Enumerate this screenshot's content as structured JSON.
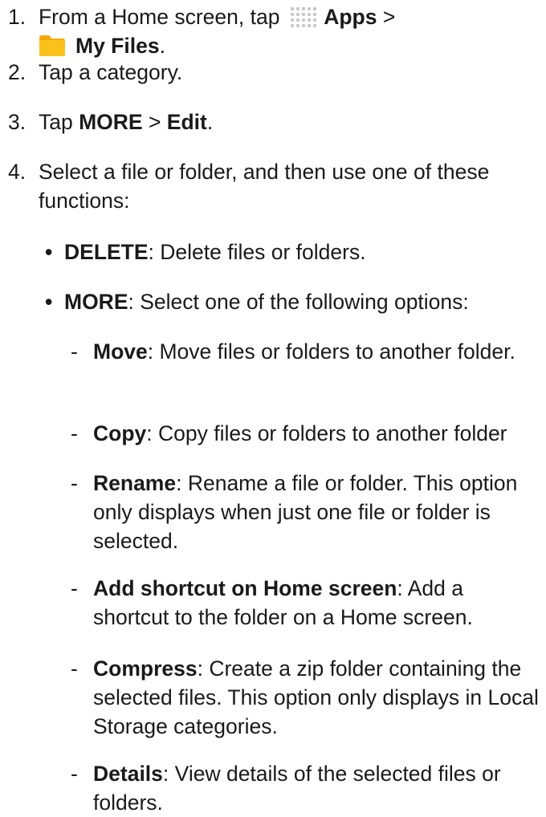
{
  "steps": [
    {
      "num": "1.",
      "pre": "From a Home screen, tap",
      "apps": "Apps",
      "sep": " >",
      "folder": "My Files",
      "end": "."
    },
    {
      "num": "2.",
      "text": "Tap a category."
    },
    {
      "num": "3.",
      "pre": "Tap ",
      "more": "MORE",
      "sep": " > ",
      "edit": "Edit",
      "end": "."
    },
    {
      "num": "4.",
      "text": "Select a file or folder, and then use one of these functions:"
    }
  ],
  "bullets": [
    {
      "marker": "•",
      "term": "DELETE",
      "desc": ": Delete files or folders."
    },
    {
      "marker": "•",
      "term": "MORE",
      "desc": ": Select one of the following options:"
    }
  ],
  "subitems": [
    {
      "marker": "-",
      "term": "Move",
      "desc": ": Move files or folders to another folder."
    },
    {
      "marker": "-",
      "term": "Copy",
      "desc": ": Copy files or folders to another folder"
    },
    {
      "marker": "-",
      "term": "Rename",
      "desc": ": Rename a file or folder. This option only displays when just one file or folder is selected."
    },
    {
      "marker": "-",
      "term": "Add shortcut on Home screen",
      "desc": ": Add a shortcut to the folder on a Home screen."
    },
    {
      "marker": "-",
      "term": "Compress",
      "desc": ": Create a zip folder containing the selected files. This option only displays in Local Storage categories."
    },
    {
      "marker": "-",
      "term": "Details",
      "desc": ": View details of the selected files or folders."
    }
  ],
  "icons": {
    "apps": "apps-grid-icon",
    "folder": "my-files-folder-icon",
    "apps_color": "#c9c9c9",
    "folder_color": "#f9c11a",
    "folder_tab_color": "#f4a80c"
  }
}
